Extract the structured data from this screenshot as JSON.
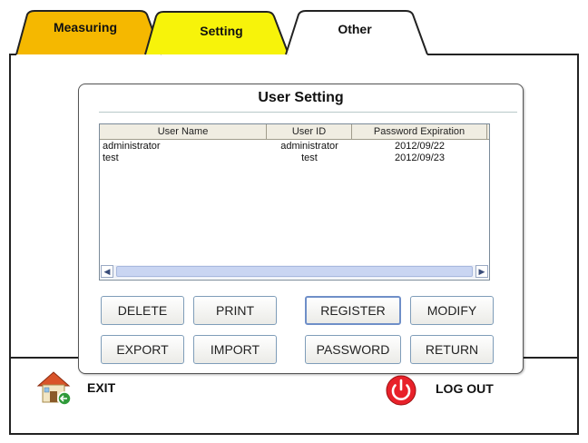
{
  "tabs": [
    {
      "label": "Measuring",
      "color": "#f5b800"
    },
    {
      "label": "Setting",
      "color": "#f7f30a"
    },
    {
      "label": "Other",
      "color": "#ffffff"
    }
  ],
  "dialog": {
    "title": "User Setting",
    "columns": [
      "User Name",
      "User ID",
      "Password Expiration"
    ],
    "rows": [
      {
        "name": "administrator",
        "id": "administrator",
        "expiration": "2012/09/22"
      },
      {
        "name": "test",
        "id": "test",
        "expiration": "2012/09/23"
      }
    ],
    "buttons": {
      "delete": "DELETE",
      "print": "PRINT",
      "register": "REGISTER",
      "modify": "MODIFY",
      "export": "EXPORT",
      "import": "IMPORT",
      "password": "PASSWORD",
      "return": "RETURN"
    }
  },
  "footer": {
    "exit": "EXIT",
    "logout": "LOG OUT"
  },
  "icons": {
    "exit": "house-exit-icon",
    "logout": "power-icon"
  }
}
